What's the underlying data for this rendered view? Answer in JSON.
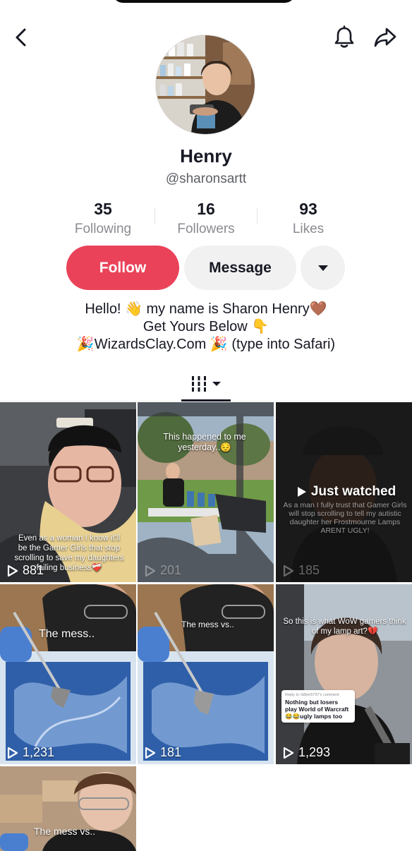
{
  "header": {
    "back_icon": "chevron-left-icon",
    "bell_icon": "bell-icon",
    "share_icon": "share-arrow-icon"
  },
  "profile": {
    "name": "Henry",
    "handle": "@sharonsartt"
  },
  "stats": [
    {
      "value": "35",
      "label": "Following"
    },
    {
      "value": "16",
      "label": "Followers"
    },
    {
      "value": "93",
      "label": "Likes"
    }
  ],
  "actions": {
    "follow_label": "Follow",
    "message_label": "Message",
    "more_icon": "caret-down-icon"
  },
  "bio": [
    "Hello! 👋 my name is Sharon Henry🤎",
    "Get Yours Below 👇",
    "🎉WizardsClay.Com 🎉 (type into Safari)"
  ],
  "tabs": {
    "active_icon": "grid-videos-icon",
    "dropdown_icon": "caret-down-icon"
  },
  "colors": {
    "follow": "#ea4359",
    "secondary_button": "#f1f1f2",
    "muted_text": "#8a8b91"
  },
  "videos": [
    {
      "caption": "Even as a woman I know it'll be the Gamer Girls that stop scrolling to save my daughters failing business❤️‍🩹",
      "views": "881"
    },
    {
      "caption": "This happened to me yesterday..😔",
      "views": "201"
    },
    {
      "overlay": "Just watched",
      "caption": "As a man I fully trust that Gamer Girls will stop scrolling to tell my autistic daughter her Frostmourne Lamps ARENT UGLY!",
      "views": "185"
    },
    {
      "caption": "The mess..",
      "views": "1,231"
    },
    {
      "caption": "The mess vs..",
      "views": "181"
    },
    {
      "caption": "So this is what WoW gamers think of my lamp art?💔",
      "comment_reply": "Reply to Gilber5797's comment",
      "comment": "Nothing but losers play World of Warcraft 😂😂ugly lamps too",
      "views": "1,293"
    },
    {
      "caption": "The mess vs..",
      "views": ""
    }
  ]
}
